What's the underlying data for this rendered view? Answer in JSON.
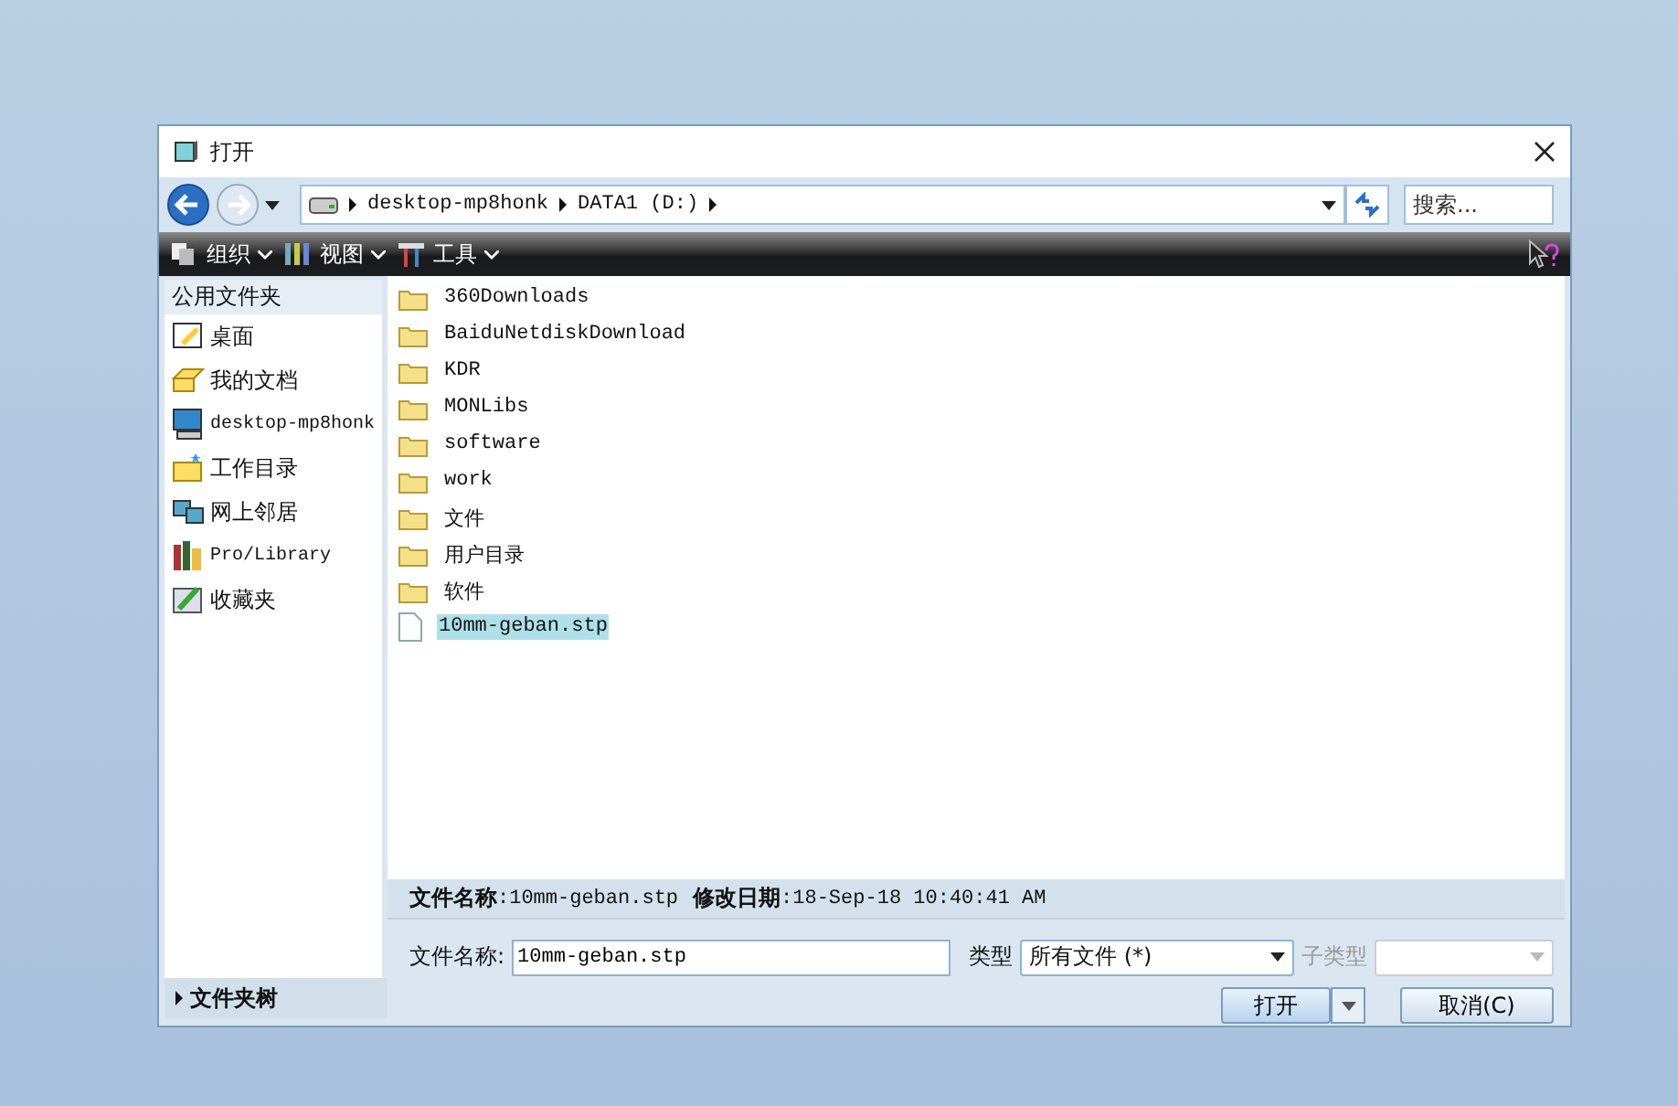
{
  "window": {
    "title": "打开"
  },
  "nav": {
    "path": [
      "desktop-mp8honk",
      "DATA1 (D:)"
    ],
    "search": {
      "placeholder": "搜索..."
    }
  },
  "toolbar": [
    {
      "label": "组织",
      "kind": "organize"
    },
    {
      "label": "视图",
      "kind": "view"
    },
    {
      "label": "工具",
      "kind": "tools"
    }
  ],
  "sidebar": {
    "header": "公用文件夹",
    "items": [
      {
        "label": "桌面",
        "kind": "desktop"
      },
      {
        "label": "我的文档",
        "kind": "documents"
      },
      {
        "label": "desktop-mp8honk",
        "kind": "computer"
      },
      {
        "label": "工作目录",
        "kind": "workdir"
      },
      {
        "label": "网上邻居",
        "kind": "network"
      },
      {
        "label": "Pro/Library",
        "kind": "library"
      },
      {
        "label": "收藏夹",
        "kind": "favorites"
      }
    ],
    "footer": "文件夹树"
  },
  "files": [
    {
      "name": "360Downloads",
      "kind": "folder",
      "selected": false
    },
    {
      "name": "BaiduNetdiskDownload",
      "kind": "folder",
      "selected": false
    },
    {
      "name": "KDR",
      "kind": "folder",
      "selected": false
    },
    {
      "name": "MONLibs",
      "kind": "folder",
      "selected": false
    },
    {
      "name": "software",
      "kind": "folder",
      "selected": false
    },
    {
      "name": "work",
      "kind": "folder",
      "selected": false
    },
    {
      "name": "文件",
      "kind": "folder",
      "selected": false
    },
    {
      "name": "用户目录",
      "kind": "folder",
      "selected": false
    },
    {
      "name": "软件",
      "kind": "folder",
      "selected": false
    },
    {
      "name": "10mm-geban.stp",
      "kind": "file",
      "selected": true
    }
  ],
  "info": {
    "name_label": "文件名称",
    "name_value": ":10mm-geban.stp",
    "date_label": "修改日期",
    "date_value": ":18-Sep-18 10:40:41 AM"
  },
  "filename": {
    "label": "文件名称:",
    "value": "10mm-geban.stp"
  },
  "type": {
    "label": "类型",
    "value": "所有文件 (*)"
  },
  "subtype": {
    "label": "子类型",
    "disabled": true
  },
  "buttons": {
    "open": "打开",
    "cancel": "取消(C)"
  }
}
